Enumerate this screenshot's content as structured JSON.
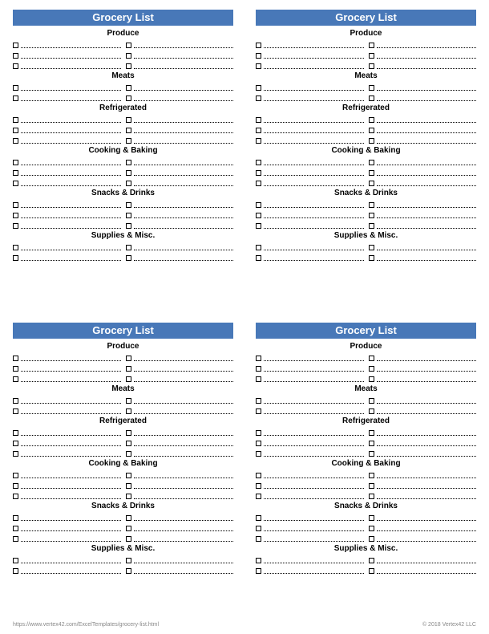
{
  "title": "Grocery List",
  "sections": [
    {
      "label": "Produce",
      "rows": 3
    },
    {
      "label": "Meats",
      "rows": 2
    },
    {
      "label": "Refrigerated",
      "rows": 3
    },
    {
      "label": "Cooking & Baking",
      "rows": 3
    },
    {
      "label": "Snacks & Drinks",
      "rows": 3
    },
    {
      "label": "Supplies & Misc.",
      "rows": 2
    }
  ],
  "footer": {
    "url": "https://www.vertex42.com/ExcelTemplates/grocery-list.html",
    "copyright": "© 2018 Vertex42 LLC"
  }
}
